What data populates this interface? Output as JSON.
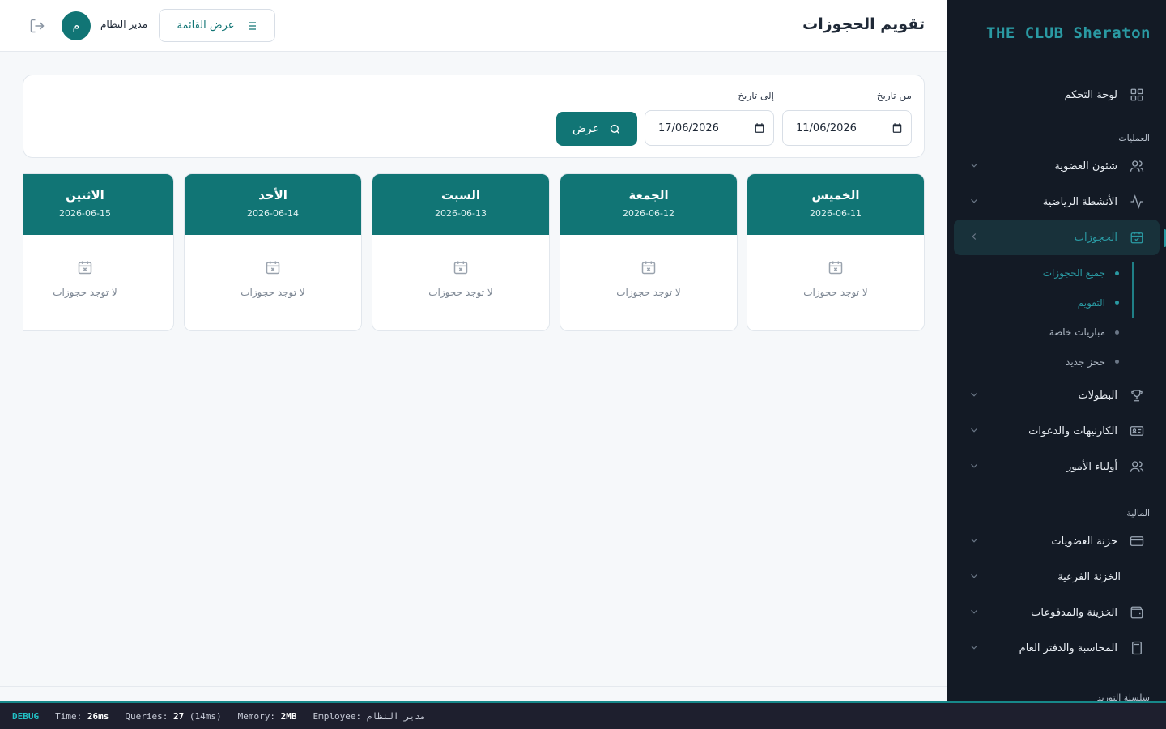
{
  "sidebar": {
    "brand": "THE CLUB Sheraton",
    "dashboard": "لوحة التحكم",
    "section_operations": "العمليات",
    "membership": "شئون العضوية",
    "sports": "الأنشطة الرياضية",
    "bookings": "الحجوزات",
    "sub_all": "جميع الحجوزات",
    "sub_calendar": "التقويم",
    "sub_matches": "مباريات خاصة",
    "sub_new": "حجز جديد",
    "championships": "البطولات",
    "cards": "الكارنيهات والدعوات",
    "guardians": "أولياء الأمور",
    "section_finance": "المالية",
    "memberships_treasury": "خزنة العضويات",
    "branch_treasury": "الخزنة الفرعية",
    "treasury_payments": "الخزينة والمدفوعات",
    "accounting": "المحاسبة والدفتر العام",
    "section_supply": "سلسلة التوريد"
  },
  "header": {
    "title": "تقويم الحجوزات",
    "list_view": "عرض القائمة",
    "user_name": "مدير النظام",
    "avatar_letter": "م"
  },
  "filter": {
    "from_label": "من تاريخ",
    "to_label": "إلى تاريخ",
    "from_value": "11/06/2026",
    "to_value": "17/06/2026",
    "show_label": "عرض"
  },
  "days": [
    {
      "name": "الخميس",
      "date": "2026-06-11",
      "empty": "لا توجد حجوزات"
    },
    {
      "name": "الجمعة",
      "date": "2026-06-12",
      "empty": "لا توجد حجوزات"
    },
    {
      "name": "السبت",
      "date": "2026-06-13",
      "empty": "لا توجد حجوزات"
    },
    {
      "name": "الأحد",
      "date": "2026-06-14",
      "empty": "لا توجد حجوزات"
    },
    {
      "name": "الاثنين",
      "date": "2026-06-15",
      "empty": "لا توجد حجوزات"
    }
  ],
  "debug": {
    "tag": "DEBUG",
    "time_label": "Time:",
    "time_value": "26ms",
    "queries_label": "Queries:",
    "queries_value": "27",
    "queries_ms": "(14ms)",
    "memory_label": "Memory:",
    "memory_value": "2MB",
    "employee_label": "Employee:",
    "employee_value": "مدير النظام"
  },
  "colors": {
    "accent": "#117575",
    "sidebar_bg": "#131a25",
    "brand": "#2a9aa3"
  }
}
